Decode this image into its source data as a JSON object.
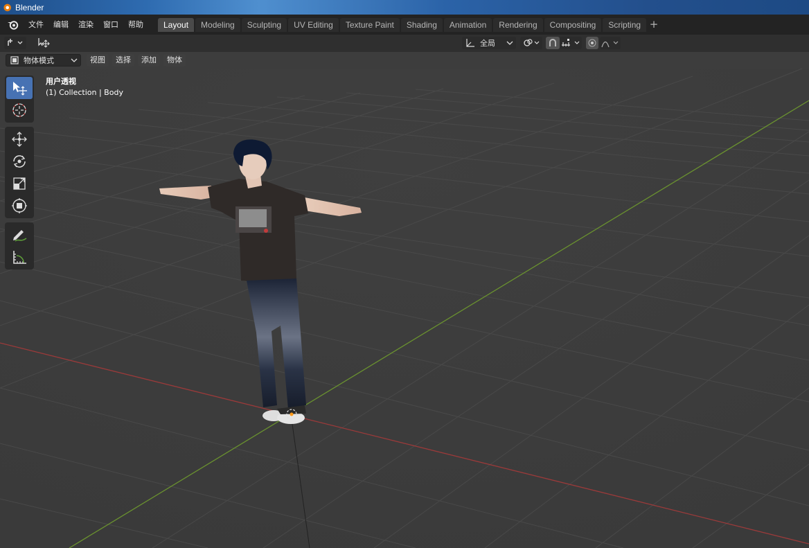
{
  "window": {
    "title": "Blender"
  },
  "menu": [
    "文件",
    "编辑",
    "渲染",
    "窗口",
    "帮助"
  ],
  "workspaces": {
    "active": "Layout",
    "tabs": [
      "Layout",
      "Modeling",
      "Sculpting",
      "UV Editing",
      "Texture Paint",
      "Shading",
      "Animation",
      "Rendering",
      "Compositing",
      "Scripting"
    ]
  },
  "header": {
    "transform_orientation": "全局",
    "icons": [
      "editor-type-icon",
      "object-transform-icon",
      "orientation-icon",
      "pivot-icon",
      "snap-icon",
      "snap-increment-icon",
      "proportional-edit-icon",
      "falloff-icon"
    ]
  },
  "mode_header": {
    "mode": "物体模式",
    "menus": [
      "视图",
      "选择",
      "添加",
      "物体"
    ]
  },
  "viewport": {
    "view_name": "用户透视",
    "collection_info": "(1) Collection | Body"
  },
  "toolbar": {
    "tools": [
      "select-box",
      "cursor",
      "move",
      "rotate",
      "scale",
      "transform",
      "annotate",
      "measure"
    ],
    "active_tool": "select-box"
  },
  "colors": {
    "x_axis": "#b23b3b",
    "y_axis": "#6b9a2f",
    "active_tool": "#4772b3",
    "background": "#3d3d3d"
  }
}
